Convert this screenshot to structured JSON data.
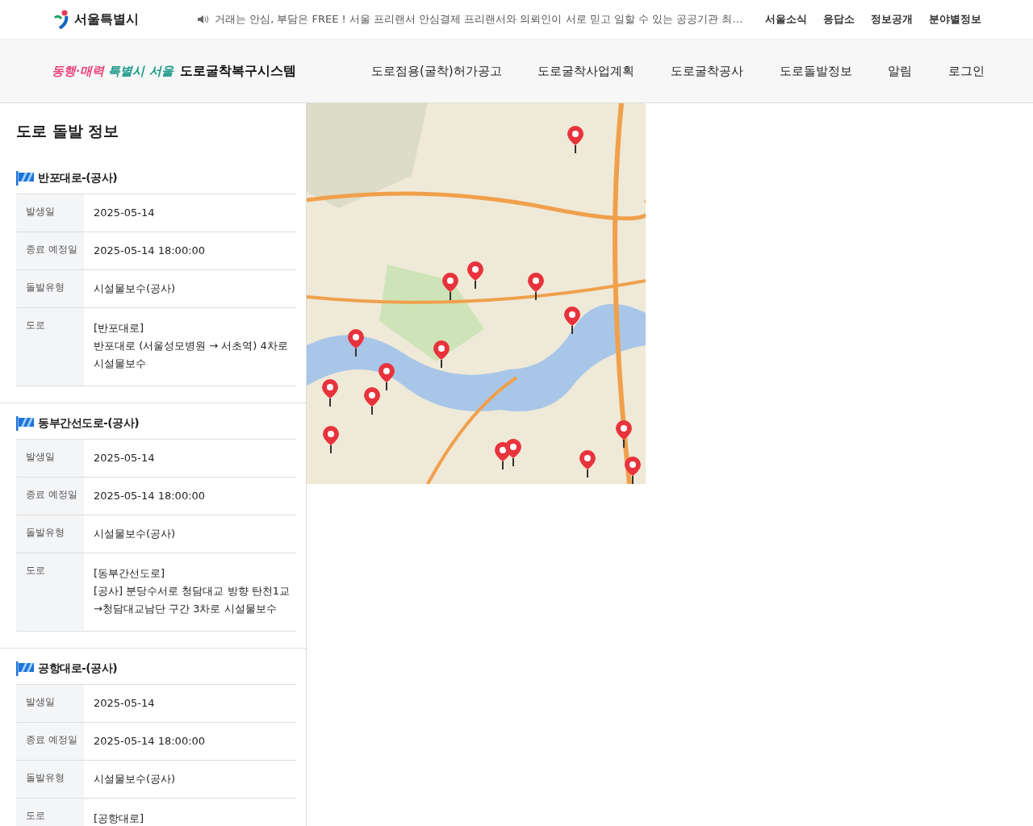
{
  "top_bar": {
    "logo_text": "서울특별시",
    "notice": "거래는 안심, 부담은 FREE ! 서울 프리랜서 안심결제 프리랜서와 의뢰인이 서로 믿고 일할 수 있는 공공기관 최…",
    "links": [
      "서울소식",
      "응답소",
      "정보공개",
      "분야별정보"
    ]
  },
  "header": {
    "slogan": [
      {
        "text": "동행·매력",
        "color": "#e8407a"
      },
      {
        "text": "특별시",
        "color": "#1a9a8a"
      },
      {
        "text": "서울",
        "color": "#1a9a8a"
      }
    ],
    "system_name": "도로굴착복구시스템",
    "nav": [
      "도로점용(굴착)허가공고",
      "도로굴착사업계획",
      "도로굴착공사",
      "도로돌발정보",
      "알림",
      "로그인"
    ]
  },
  "panel": {
    "title": "도로 돌발 정보",
    "incidents": [
      {
        "title": "반포대로-(공사)",
        "fields": [
          {
            "label": "발생일",
            "value": [
              "2025-05-14"
            ]
          },
          {
            "label": "종료 예정일",
            "value": [
              "2025-05-14 18:00:00"
            ]
          },
          {
            "label": "돌발유형",
            "value": [
              "시설물보수(공사)"
            ]
          },
          {
            "label": "도로",
            "value": [
              "[반포대로]",
              "반포대로 (서울성모병원 → 서초역) 4차로 시설물보수"
            ]
          }
        ]
      },
      {
        "title": "동부간선도로-(공사)",
        "fields": [
          {
            "label": "발생일",
            "value": [
              "2025-05-14"
            ]
          },
          {
            "label": "종료 예정일",
            "value": [
              "2025-05-14 18:00:00"
            ]
          },
          {
            "label": "돌발유형",
            "value": [
              "시설물보수(공사)"
            ]
          },
          {
            "label": "도로",
            "value": [
              "[동부간선도로]",
              "[공사] 분당수서로 청담대교 방향 탄천1교→청담대교남단 구간 3차로 시설물보수"
            ]
          }
        ]
      },
      {
        "title": "공항대로-(공사)",
        "fields": [
          {
            "label": "발생일",
            "value": [
              "2025-05-14"
            ]
          },
          {
            "label": "종료 예정일",
            "value": [
              "2025-05-14 18:00:00"
            ]
          },
          {
            "label": "돌발유형",
            "value": [
              "시설물보수(공사)"
            ]
          },
          {
            "label": "도로",
            "value": [
              "[공항대로]"
            ]
          }
        ]
      }
    ]
  }
}
